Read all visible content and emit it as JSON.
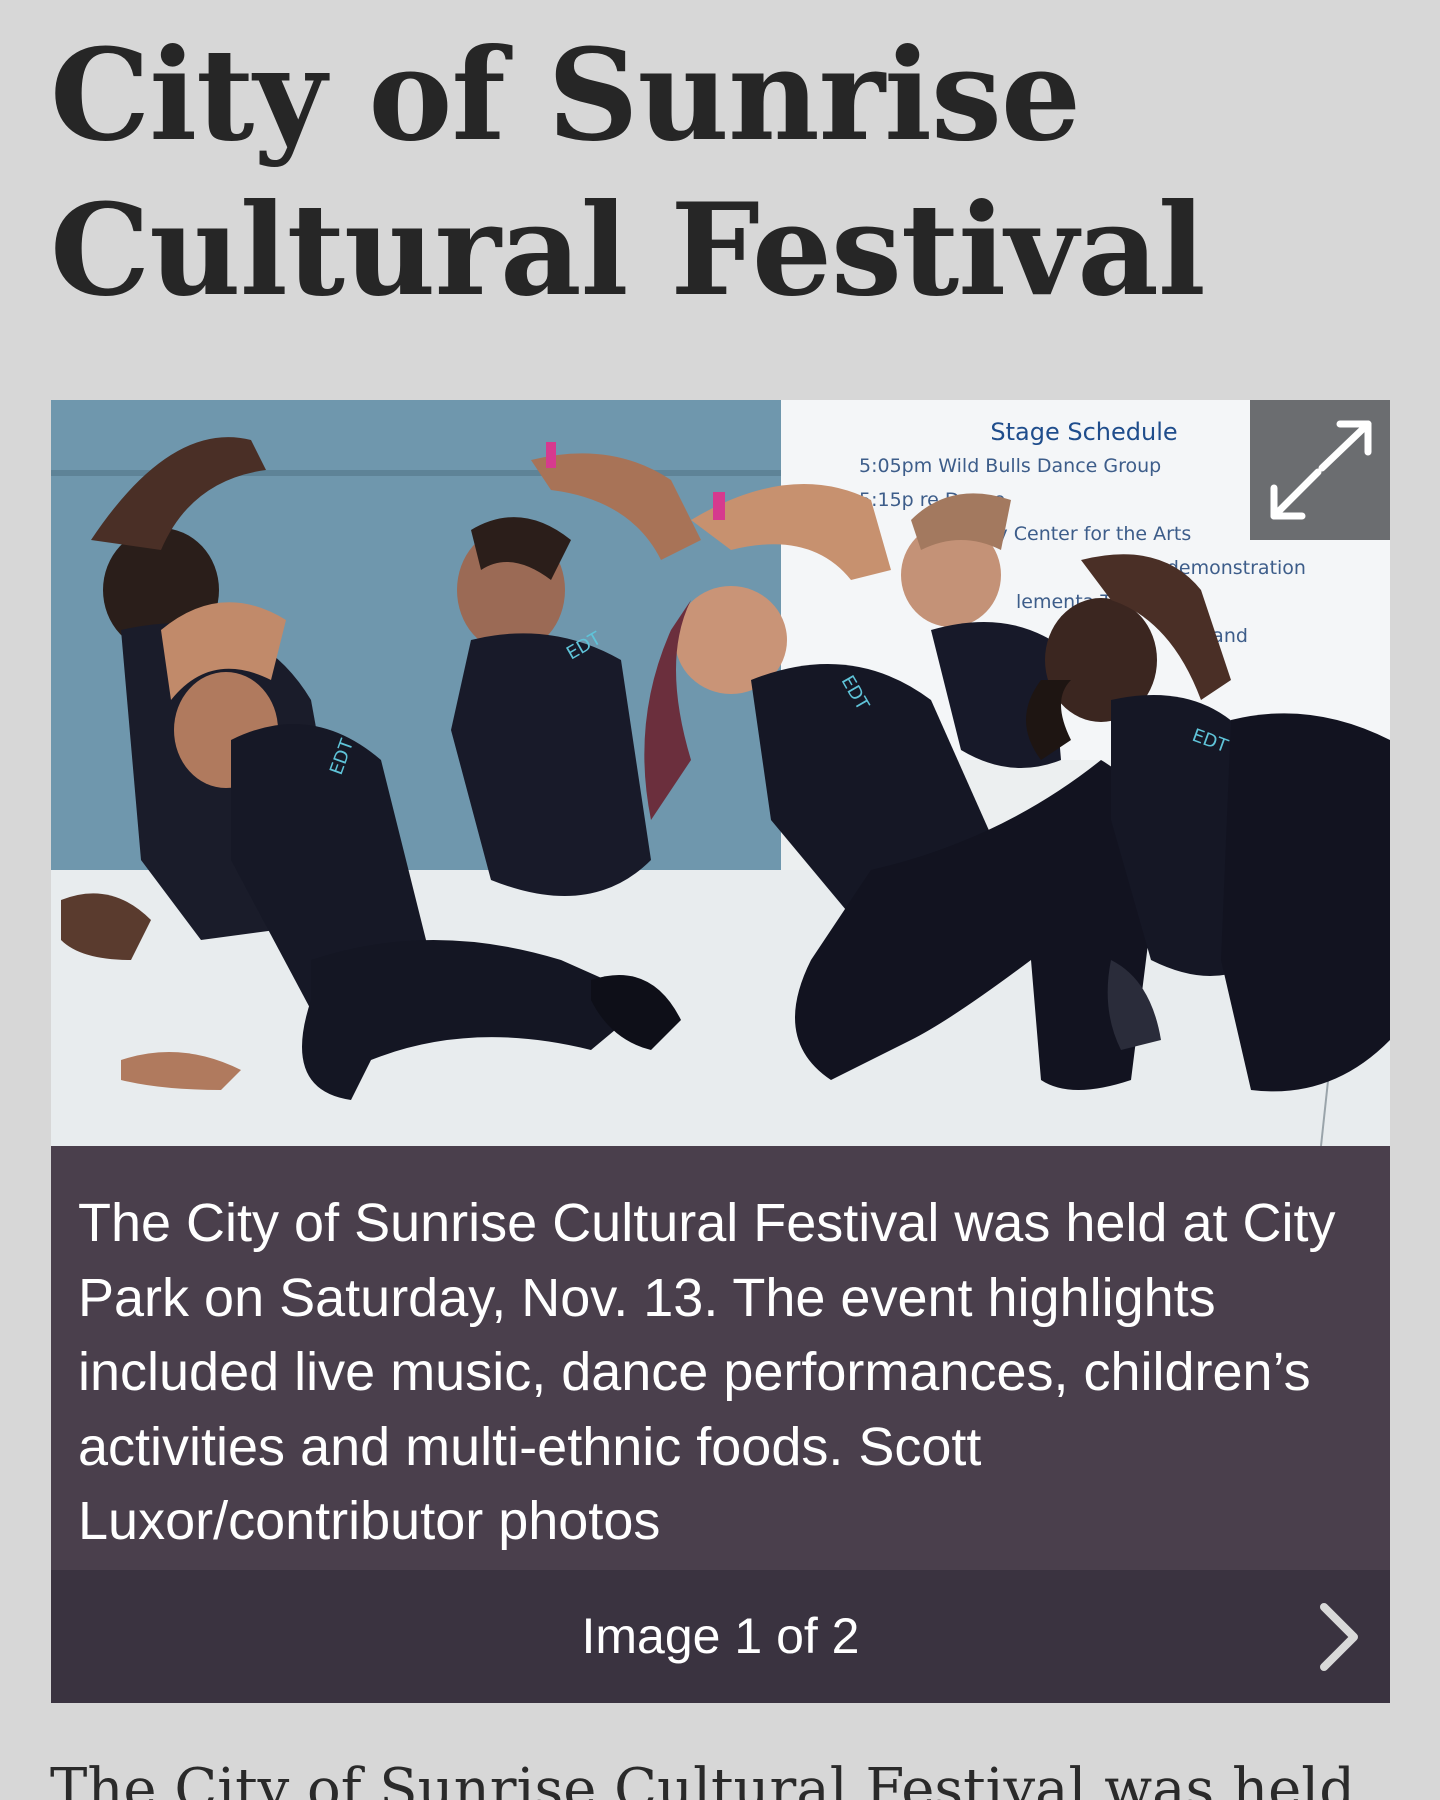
{
  "article": {
    "title": "City of Sunrise Cultural Festival",
    "body_preview": "The City of Sunrise Cultural Festival was held"
  },
  "gallery": {
    "caption": "The City of Sunrise Cultural Festival was held at City Park on Saturday, Nov. 13. The event highlights included live music, dance performances, children’s activities and multi-ethnic foods. Scott Luxor/contributor photos",
    "counter": "Image 1 of 2",
    "current_image": 1,
    "total_images": 2,
    "expand_icon": "expand-arrows-icon",
    "next_icon": "chevron-right-icon",
    "photo": {
      "sign_title": "Stage Schedule",
      "sign_lines": [
        "5:05pm  Wild Bulls Dance Group",
        "5:15p       re Dance",
        "ty Center for the Arts",
        "ss demonstration",
        "lementa          Team",
        "ng Band"
      ],
      "shirt_logo": "EDT"
    }
  },
  "colors": {
    "page_background": "#d7d7d7",
    "caption_background": "#4a3f4c",
    "nav_background": "#3a3340",
    "headline_text": "#262626",
    "expand_button_background": "#6b6d70"
  }
}
